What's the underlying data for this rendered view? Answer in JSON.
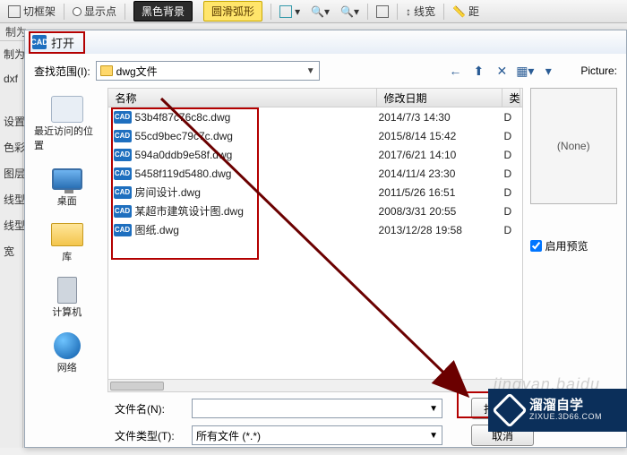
{
  "toolbar": {
    "item1": "切框架",
    "item2": "显示点",
    "btn_dark": "黑色背景",
    "btn_yellow": "圆滑弧形",
    "item_linewidth": "线宽",
    "item_dist": "距"
  },
  "second": {
    "label1": "制为",
    "label2": "制为"
  },
  "leftside": [
    "dxf",
    "设置",
    "色彩",
    "图层",
    "线型",
    "线型",
    "宽"
  ],
  "dialog": {
    "title": "打开",
    "lookin_label": "查找范围(I):",
    "folder": "dwg文件",
    "picture_label": "Picture:",
    "preview_none": "(None)",
    "enable_preview": "启用预览",
    "filename_label": "文件名(N):",
    "filetype_label": "文件类型(T):",
    "filetype_value": "所有文件 (*.*)",
    "open_btn": "打开",
    "cancel_btn": "取消"
  },
  "columns": {
    "name": "名称",
    "date": "修改日期",
    "type": "类"
  },
  "files": [
    {
      "name": "53b4f87c76c8c.dwg",
      "date": "2014/7/3 14:30",
      "t": "D"
    },
    {
      "name": "55cd9bec79c7c.dwg",
      "date": "2015/8/14 15:42",
      "t": "D"
    },
    {
      "name": "594a0ddb9e58f.dwg",
      "date": "2017/6/21 14:10",
      "t": "D"
    },
    {
      "name": "5458f119d5480.dwg",
      "date": "2014/11/4 23:30",
      "t": "D"
    },
    {
      "name": "房间设计.dwg",
      "date": "2011/5/26 16:51",
      "t": "D"
    },
    {
      "name": "某超市建筑设计图.dwg",
      "date": "2008/3/31 20:55",
      "t": "D"
    },
    {
      "name": "图纸.dwg",
      "date": "2013/12/28 19:58",
      "t": "D"
    }
  ],
  "places": {
    "recent": "最近访问的位置",
    "desktop": "桌面",
    "library": "库",
    "computer": "计算机",
    "network": "网络"
  },
  "brand": {
    "cn": "溜溜自学",
    "en": "ZIXUE.3D66.COM"
  },
  "watermark": "jingyan.baidu"
}
